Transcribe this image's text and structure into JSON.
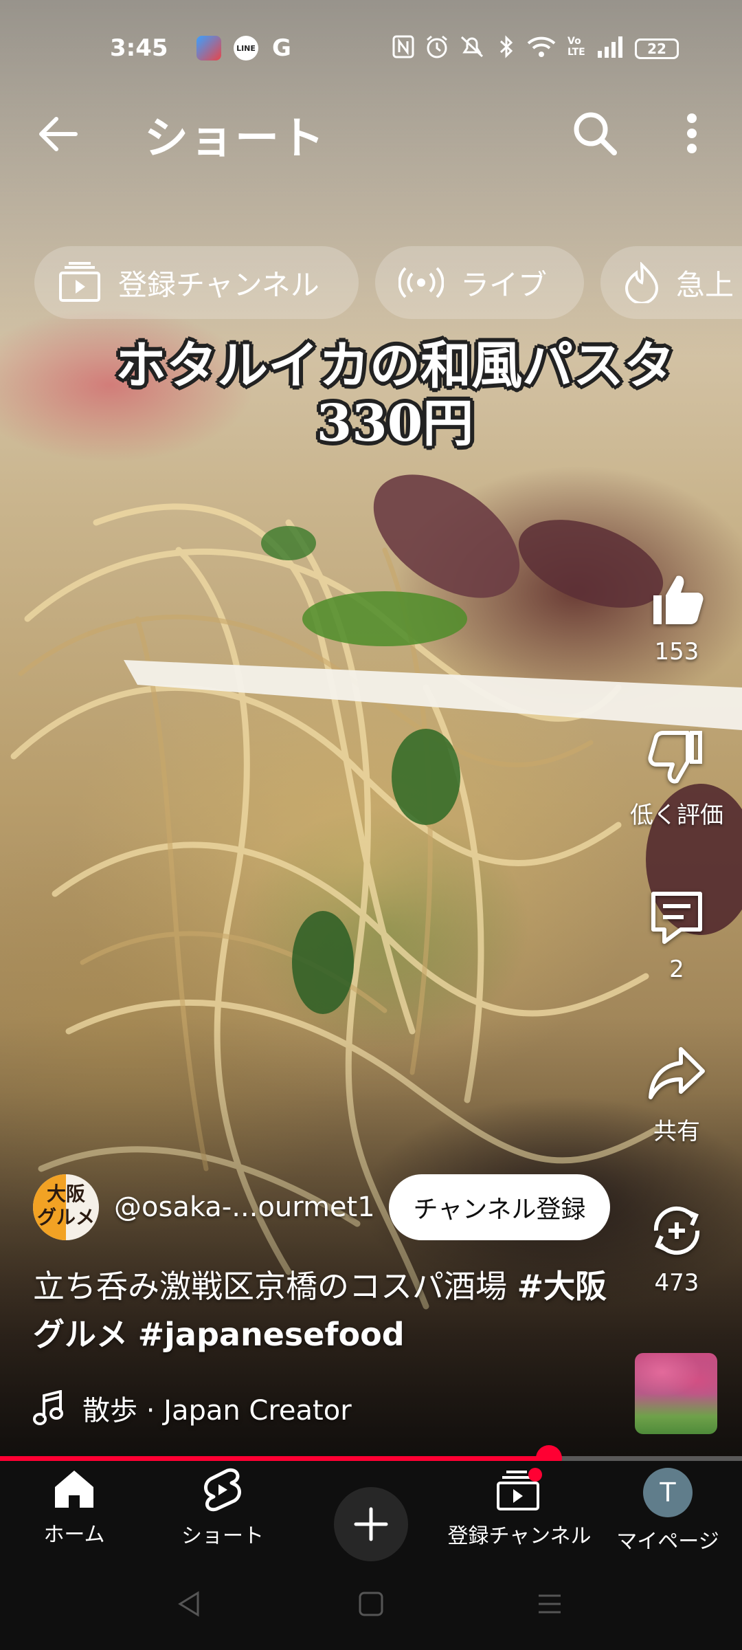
{
  "status_bar": {
    "time": "3:45",
    "app_icons": [
      "news-app-icon",
      "line-app-icon",
      "google-app-icon"
    ],
    "line_label": "LINE",
    "google_label": "G",
    "battery": "22",
    "volte_label": "Vo LTE"
  },
  "header": {
    "title": "ショート"
  },
  "chips": [
    {
      "label": "登録チャンネル",
      "icon": "subscriptions-icon"
    },
    {
      "label": "ライブ",
      "icon": "live-icon"
    },
    {
      "label": "急上",
      "icon": "trending-icon"
    }
  ],
  "video": {
    "overlay_line1": "ホタルイカの和風パスタ",
    "overlay_line2": "330円",
    "progress_fraction": 0.74
  },
  "actions": {
    "like_count": "153",
    "dislike_label": "低く評価",
    "comment_count": "2",
    "share_label": "共有",
    "remix_count": "473"
  },
  "channel": {
    "avatar_text": "大阪\nグルメ",
    "name": "@osaka-...ourmet1",
    "subscribe_label": "チャンネル登録"
  },
  "description": {
    "text": "立ち呑み激戦区京橋のコスパ酒場 ",
    "tag1": "#大阪グルメ",
    "tag2": "#japanesefood"
  },
  "music": {
    "label": "散歩 · Japan Creator"
  },
  "bottom_nav": {
    "home": "ホーム",
    "shorts": "ショート",
    "subscriptions": "登録チャンネル",
    "mypage": "マイページ",
    "avatar_letter": "T"
  },
  "colors": {
    "accent": "#ff0033",
    "nav_background": "#0f0f0f",
    "avatar": "#607d8b"
  }
}
